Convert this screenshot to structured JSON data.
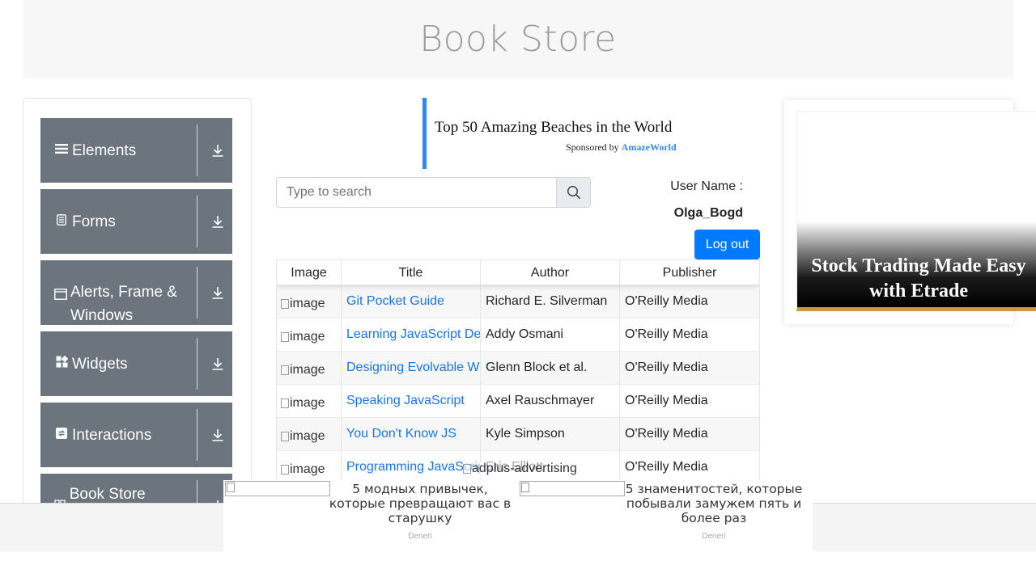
{
  "header": {
    "title": "Book Store"
  },
  "sidebar": {
    "groups": [
      {
        "label": "Elements",
        "icon": "menu-icon"
      },
      {
        "label": "Forms",
        "icon": "form-icon"
      },
      {
        "label": "Alerts, Frame & Windows",
        "icon": "window-icon"
      },
      {
        "label": "Widgets",
        "icon": "widgets-icon"
      },
      {
        "label": "Interactions",
        "icon": "interactions-icon"
      },
      {
        "label": "Book Store Application",
        "icon": "book-icon"
      }
    ]
  },
  "ad_top": {
    "title": "Top 50 Amazing Beaches in the World",
    "sponsored_prefix": "Sponsored by",
    "sponsor": "AmazeWorld"
  },
  "search": {
    "placeholder": "Type to search",
    "value": ""
  },
  "user": {
    "label": "User Name :",
    "name": "Olga_Bogd",
    "logout_label": "Log out"
  },
  "table": {
    "columns": [
      "Image",
      "Title",
      "Author",
      "Publisher"
    ],
    "image_alt": "image",
    "rows": [
      {
        "title": "Git Pocket Guide",
        "author": "Richard E. Silverman",
        "publisher": "O'Reilly Media"
      },
      {
        "title": "Learning JavaScript Design Patterns",
        "author": "Addy Osmani",
        "publisher": "O'Reilly Media"
      },
      {
        "title": "Designing Evolvable Web APIs with ASP.NET",
        "author": "Glenn Block et al.",
        "publisher": "O'Reilly Media"
      },
      {
        "title": "Speaking JavaScript",
        "author": "Axel Rauschmayer",
        "publisher": "O'Reilly Media"
      },
      {
        "title": "You Don't Know JS",
        "author": "Kyle Simpson",
        "publisher": "O'Reilly Media"
      },
      {
        "title": "Programming JavaScript Applications",
        "author": "Eric Elliott",
        "publisher": "O'Reilly Media"
      }
    ]
  },
  "ad_side": {
    "text": "Stock Trading Made Easy with Etrade"
  },
  "native_ad": {
    "label": "adplus-advertising",
    "items": [
      {
        "title": "5 модных привычек, которые превращают вас в старушку",
        "source": "Deneri"
      },
      {
        "title": "5 знаменитостей, которые побывали замужем пять и более раз",
        "source": "Deneri"
      }
    ]
  },
  "colors": {
    "sidebar_bg": "#6c757d",
    "primary": "#007bff",
    "link": "#1a73e8",
    "ad_accent": "#2f89f4"
  }
}
